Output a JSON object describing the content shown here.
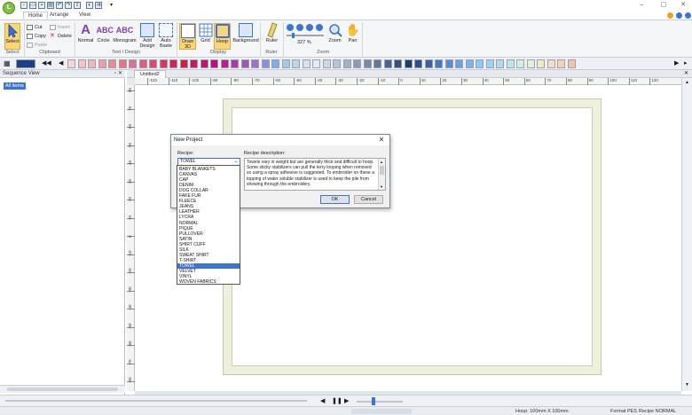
{
  "app": {
    "logo_letter": "L",
    "tabs": [
      "Home",
      "Arrange",
      "View"
    ],
    "active_tab": "Home"
  },
  "ribbon": {
    "select": {
      "label": "Select",
      "group": "Select"
    },
    "clipboard": {
      "cut": "Cut",
      "copy": "Copy",
      "paste": "Paste",
      "insert": "Insert",
      "delete": "Delete",
      "group": "Clipboard"
    },
    "textdesign": {
      "normal": "Normal",
      "circle": "Circle",
      "monogram": "Monogram",
      "add_design": "Add Design",
      "auto_baste": "Auto Baste",
      "group": "Text / Design"
    },
    "display": {
      "draw3d": "Draw 3D",
      "grid": "Grid",
      "hoop": "Hoop",
      "background": "Background",
      "group": "Display"
    },
    "ruler": {
      "label": "Ruler",
      "group": "Ruler"
    },
    "zoom": {
      "percent": "327 %",
      "zoom_label": "Zoom",
      "pan_label": "Pan",
      "group": "Zoom"
    }
  },
  "palette_colors": [
    "#1d3f8a",
    "#f4d7d7",
    "#f2c4c4",
    "#f0b5b8",
    "#ee9fa6",
    "#eb8a95",
    "#e87584",
    "#e46f8c",
    "#e05d7d",
    "#dc4a6e",
    "#d8375f",
    "#d42450",
    "#cf1e4a",
    "#c9185c",
    "#c3126e",
    "#bc0c80",
    "#b51e92",
    "#ad3aa4",
    "#a456b6",
    "#9a72c8",
    "#8f8eda",
    "#84aaec",
    "#a7c7e8",
    "#bed4ec",
    "#d6e2f0",
    "#e6eaf2",
    "#cfd6e2",
    "#b9c3d4",
    "#a3b0c6",
    "#8d9db8",
    "#778aaa",
    "#61779c",
    "#4b648e",
    "#355180",
    "#1f3e72",
    "#2b4f8c",
    "#3a63a6",
    "#4977c0",
    "#5a8bd6",
    "#6b9fe6",
    "#7cb3f0",
    "#8dc7f8",
    "#9ed1f2",
    "#afdbec",
    "#c0e5e6",
    "#d1efe0",
    "#e2f0d8",
    "#f0e8c8",
    "#f6dcc0",
    "#f8cfb8",
    "#f4c0b0"
  ],
  "sequence_view": {
    "title": "Sequence View",
    "all_items": "All items"
  },
  "document": {
    "tab": "Untitled2"
  },
  "ruler_labels_x": [
    "-120",
    "-110",
    "-100",
    "-90",
    "-80",
    "-70",
    "-60",
    "-50",
    "-40",
    "-30",
    "-20",
    "-10",
    "0",
    "10",
    "20",
    "30",
    "40",
    "50",
    "60",
    "70",
    "80",
    "90",
    "100",
    "110",
    "120"
  ],
  "ruler_labels_y": [
    "80",
    "70",
    "60",
    "50",
    "40",
    "30",
    "20",
    "10",
    "0",
    "-10",
    "-20",
    "-30",
    "-40",
    "-50",
    "-60",
    "-70",
    "-80"
  ],
  "dialog": {
    "title": "New Project",
    "recipe_label": "Recipe:",
    "recipe_value": "TOWEL",
    "desc_label": "Recipe description:",
    "description": "Towels vary in weight but are generally thick and difficult to hoop. Some sticky stabilizers can pull the terry looping when removed so using a spray adhesive is suggested. To embroider on these a topping of water soluble stabilizer is used to keep the pile from showing through the embroidery.",
    "ok": "OK",
    "cancel": "Cancel"
  },
  "recipe_options": [
    "BABY BLANKETS",
    "CANVAS",
    "CAP",
    "DENIM",
    "DOG COLLAR",
    "FAKE FUR",
    "FLEECE",
    "JEANS",
    "LEATHER",
    "LYCRA",
    "NORMAL",
    "PIQUE",
    "PULLOVER",
    "SATIN",
    "SHIRT CUFF",
    "SILK",
    "SWEAT SHIRT",
    "T-SHIRT",
    "TOWEL",
    "VELVET",
    "VINYL",
    "WOVEN FABRICS"
  ],
  "selected_option": "TOWEL",
  "status": {
    "hoop": "Hoop: 100mm X 100mm",
    "format": "Format PES",
    "recipe": "Recipe NORMAL"
  }
}
